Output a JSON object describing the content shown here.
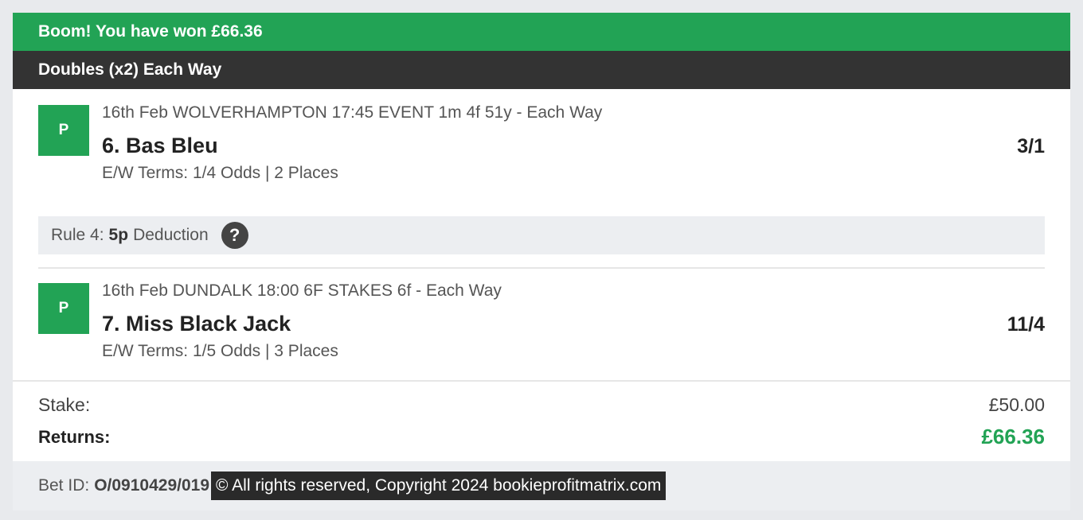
{
  "banner": {
    "win_text": "Boom! You have won £66.36"
  },
  "bet": {
    "type": "Doubles (x2) Each Way"
  },
  "selections": [
    {
      "badge": "P",
      "event": "16th Feb WOLVERHAMPTON 17:45 EVENT 1m 4f 51y - Each Way",
      "name": "6. Bas Bleu",
      "odds": "3/1",
      "terms": "E/W Terms: 1/4 Odds | 2 Places"
    },
    {
      "badge": "P",
      "event": "16th Feb DUNDALK 18:00 6F STAKES 6f - Each Way",
      "name": "7. Miss Black Jack",
      "odds": "11/4",
      "terms": "E/W Terms: 1/5 Odds | 3 Places"
    }
  ],
  "rule4": {
    "prefix": "Rule 4:",
    "amount": "5p",
    "suffix": "Deduction",
    "help_icon": "?"
  },
  "summary": {
    "stake_label": "Stake:",
    "stake_value": "£50.00",
    "returns_label": "Returns:",
    "returns_value": "£66.36"
  },
  "footer": {
    "bet_id_label": "Bet ID:",
    "bet_id_value": "O/0910429/019",
    "copyright": "© All rights reserved, Copyright 2024 bookieprofitmatrix.com"
  },
  "colors": {
    "accent_green": "#22a355",
    "header_dark": "#333333"
  }
}
